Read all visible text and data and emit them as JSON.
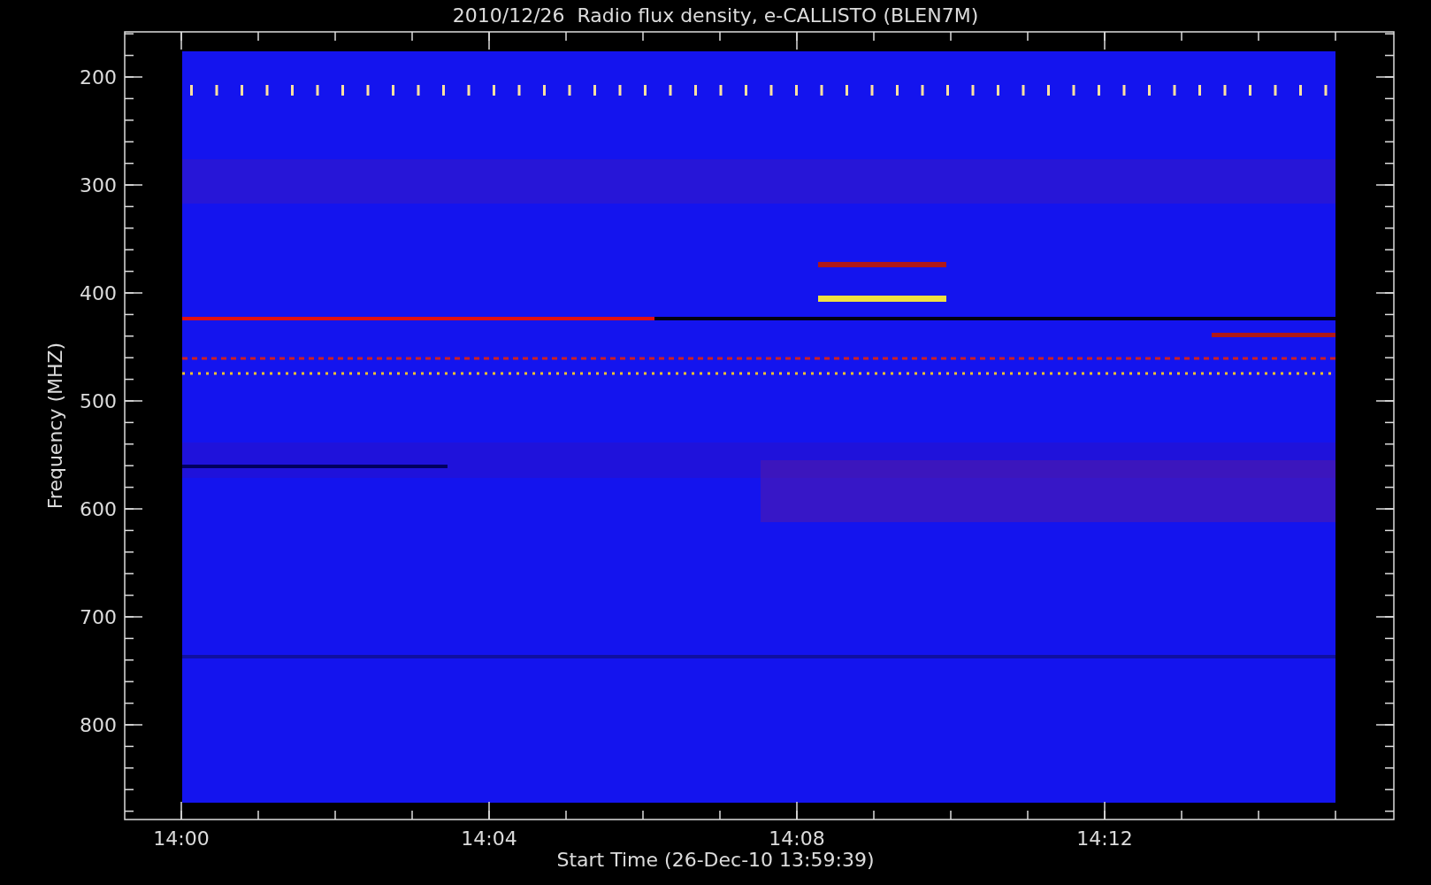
{
  "title": "2010/12/26  Radio flux density, e-CALLISTO (BLEN7M)",
  "y_axis": {
    "label": "Frequency (MHZ)",
    "ticks": [
      "200",
      "300",
      "400",
      "500",
      "600",
      "700",
      "800"
    ]
  },
  "x_axis": {
    "label": "Start Time (26-Dec-10 13:59:39)",
    "ticks": [
      "14:00",
      "14:04",
      "14:08",
      "14:12"
    ]
  }
}
